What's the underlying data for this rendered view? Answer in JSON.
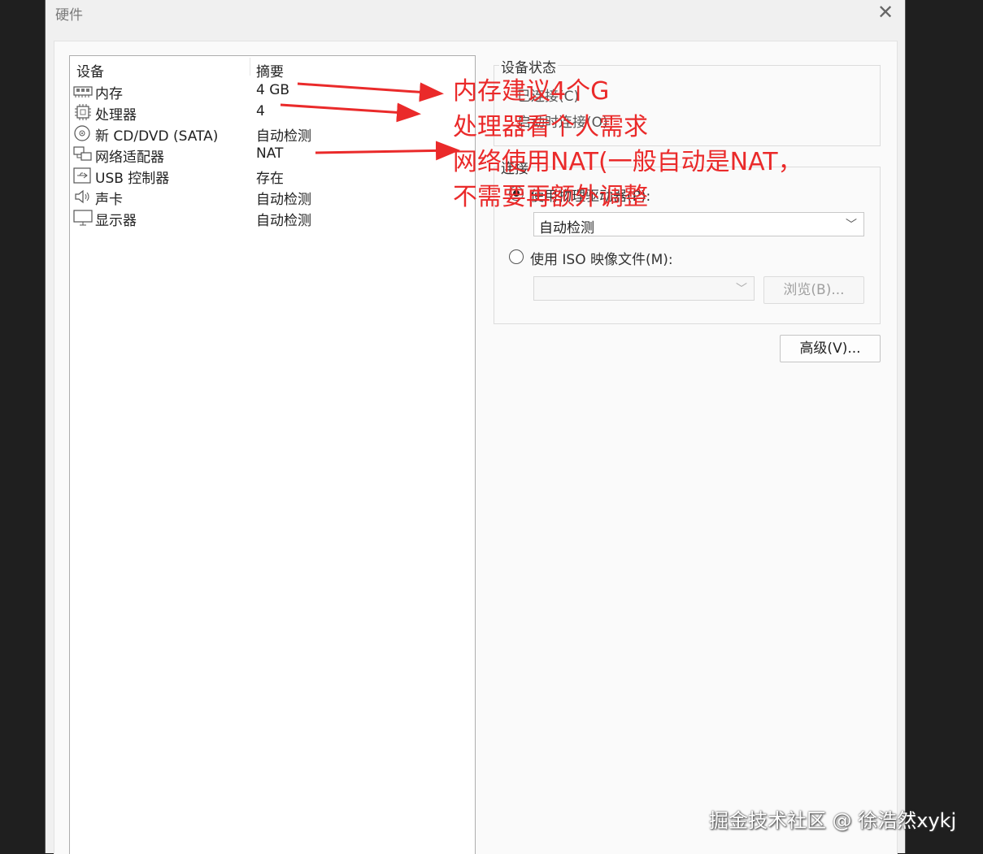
{
  "window": {
    "title": "硬件",
    "close_glyph": "✕"
  },
  "device_list": {
    "headers": {
      "device": "设备",
      "summary": "摘要"
    },
    "rows": [
      {
        "name": "内存",
        "summary": "4 GB",
        "icon": "memory-icon"
      },
      {
        "name": "处理器",
        "summary": "4",
        "icon": "processor-icon"
      },
      {
        "name": "新 CD/DVD (SATA)",
        "summary": "自动检测",
        "icon": "cd-dvd-icon"
      },
      {
        "name": "网络适配器",
        "summary": "NAT",
        "icon": "network-adapter-icon"
      },
      {
        "name": "USB 控制器",
        "summary": "存在",
        "icon": "usb-icon"
      },
      {
        "name": "声卡",
        "summary": "自动检测",
        "icon": "speaker-icon"
      },
      {
        "name": "显示器",
        "summary": "自动检测",
        "icon": "monitor-icon"
      }
    ]
  },
  "device_status": {
    "label": "设备状态",
    "connected": "已连接(C)",
    "connect_at_power_on": "启动时连接(O)"
  },
  "connection": {
    "label": "连接",
    "use_physical_drive": "使用物理驱动器(P):",
    "physical_drive_value": "自动检测",
    "use_iso": "使用 ISO 映像文件(M):",
    "iso_value": "",
    "browse_label": "浏览(B)..."
  },
  "advanced_label": "高级(V)...",
  "annotations": {
    "line1": "内存建议4个G",
    "line2": "处理器看个人需求",
    "line3": "网络使用NAT(一般自动是NAT，",
    "line4": "不需要再额外调整",
    "color": "#ea2a2a"
  },
  "watermark": "掘金技术社区 @ 徐浩然xykj"
}
